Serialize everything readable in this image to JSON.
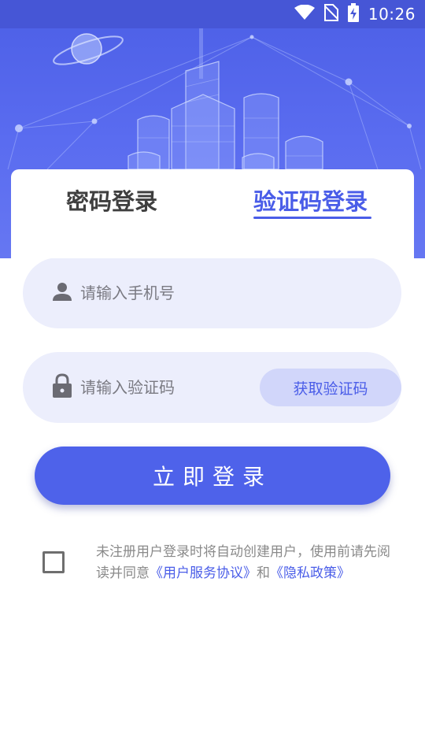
{
  "status_bar": {
    "time": "10:26",
    "icons": [
      "wifi-icon",
      "no-sim-icon",
      "battery-charging-icon"
    ]
  },
  "header": {
    "illustration": "city-buildings-network-illustration"
  },
  "tabs": [
    {
      "label": "密码登录",
      "active": false
    },
    {
      "label": "验证码登录",
      "active": true
    }
  ],
  "form": {
    "phone": {
      "placeholder": "请输入手机号",
      "value": "",
      "icon": "user-icon"
    },
    "code": {
      "placeholder": "请输入验证码",
      "value": "",
      "icon": "lock-icon"
    },
    "get_code_label": "获取验证码",
    "login_label": "立即登录"
  },
  "agreement": {
    "checked": false,
    "text_prefix": "未注册用户登录时将自动创建用户，使用前请先阅读并同意",
    "service_link": "《用户服务协议》",
    "connector": "和",
    "privacy_link": "《隐私政策》"
  },
  "colors": {
    "primary": "#4e62ea",
    "header_bg": "#5566ee",
    "input_bg": "#eceefc",
    "get_code_bg": "#d1d6fa"
  }
}
